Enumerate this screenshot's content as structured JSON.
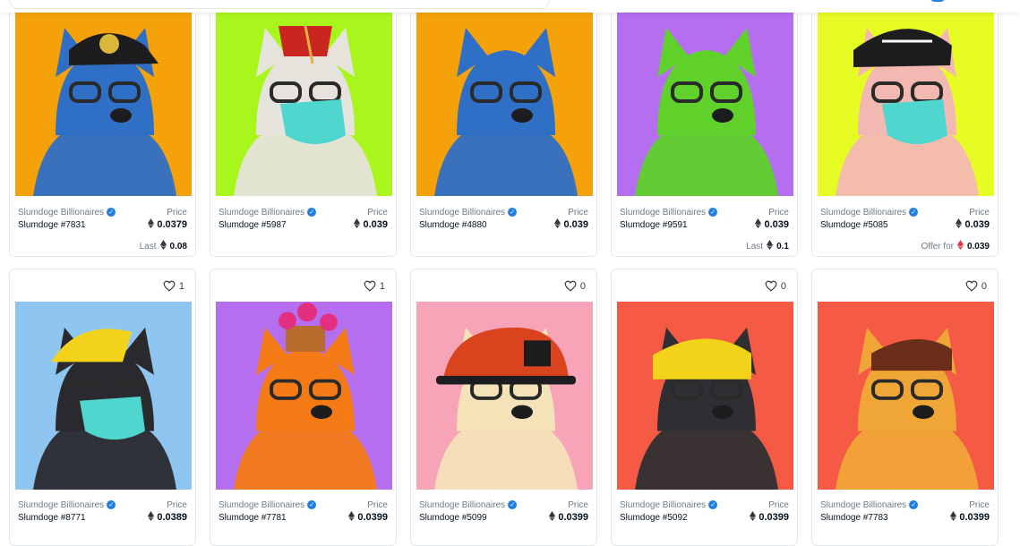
{
  "cards": [
    {
      "favorites": "",
      "collection": "Slumdoge Billionaires",
      "name": "Slumdoge #7831",
      "price_label": "Price",
      "price": "0.0379",
      "footer_label": "Last",
      "footer_value": "0.08",
      "bg": "#f5a20a",
      "skin": "#2f6fc6",
      "accessory": "cap-black",
      "mask": false
    },
    {
      "favorites": "",
      "collection": "Slumdoge Billionaires",
      "name": "Slumdoge #5987",
      "price_label": "Price",
      "price": "0.039",
      "footer_label": "",
      "footer_value": "",
      "bg": "#a9f61c",
      "skin": "#e6e2dc",
      "accessory": "fez",
      "mask": true
    },
    {
      "favorites": "",
      "collection": "Slumdoge Billionaires",
      "name": "Slumdoge #4880",
      "price_label": "Price",
      "price": "0.039",
      "footer_label": "",
      "footer_value": "",
      "bg": "#f5a20a",
      "skin": "#2f6fc6",
      "accessory": "none",
      "mask": false
    },
    {
      "favorites": "",
      "collection": "Slumdoge Billionaires",
      "name": "Slumdoge #9591",
      "price_label": "Price",
      "price": "0.039",
      "footer_label": "Last",
      "footer_value": "0.1",
      "bg": "#b56ef0",
      "skin": "#5fd12a",
      "accessory": "none",
      "mask": false
    },
    {
      "favorites": "",
      "collection": "Slumdoge Billionaires",
      "name": "Slumdoge #5085",
      "price_label": "Price",
      "price": "0.039",
      "footer_label": "Offer for",
      "footer_value": "0.039",
      "bg": "#e7fb24",
      "skin": "#f4b8b3",
      "accessory": "cap-dogecoin",
      "mask": true
    },
    {
      "favorites": "1",
      "collection": "Slumdoge Billionaires",
      "name": "Slumdoge #8771",
      "price_label": "Price",
      "price": "0.0389",
      "footer_label": "",
      "footer_value": "",
      "bg": "#8fc6f1",
      "skin": "#2a2a2e",
      "accessory": "hair-blonde",
      "mask": true
    },
    {
      "favorites": "1",
      "collection": "Slumdoge Billionaires",
      "name": "Slumdoge #7781",
      "price_label": "Price",
      "price": "0.0399",
      "footer_label": "",
      "footer_value": "",
      "bg": "#b56ef0",
      "skin": "#f47a16",
      "accessory": "flowerpot",
      "mask": false
    },
    {
      "favorites": "0",
      "collection": "Slumdoge Billionaires",
      "name": "Slumdoge #5099",
      "price_label": "Price",
      "price": "0.0399",
      "footer_label": "",
      "footer_value": "",
      "bg": "#f7a3b8",
      "skin": "#f4e2b8",
      "accessory": "helmet",
      "mask": false
    },
    {
      "favorites": "0",
      "collection": "Slumdoge Billionaires",
      "name": "Slumdoge #5092",
      "price_label": "Price",
      "price": "0.0399",
      "footer_label": "",
      "footer_value": "",
      "bg": "#f55a45",
      "skin": "#2f2f33",
      "accessory": "hair-yellow",
      "mask": false
    },
    {
      "favorites": "0",
      "collection": "Slumdoge Billionaires",
      "name": "Slumdoge #7783",
      "price_label": "Price",
      "price": "0.0399",
      "footer_label": "",
      "footer_value": "",
      "bg": "#f55a45",
      "skin": "#f0a537",
      "accessory": "hair-brown",
      "mask": false
    }
  ],
  "colors": {
    "accent": "#2081e2",
    "text": "#04111d",
    "muted": "#707a83",
    "offer_eth": "#e2373f"
  },
  "icons": {
    "favorite": "heart-outline-icon",
    "currency": "ethereum-icon",
    "verified": "verified-check-icon"
  }
}
